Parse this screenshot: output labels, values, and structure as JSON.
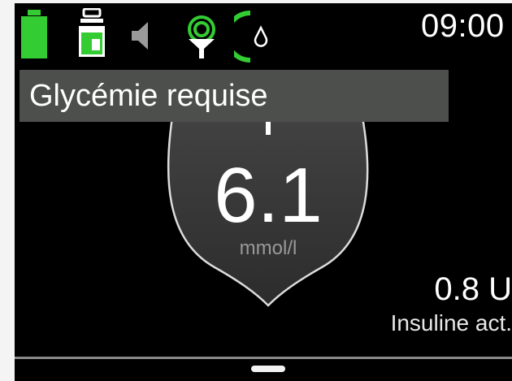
{
  "status_bar": {
    "time": "09:00",
    "icons": [
      "battery-full-icon",
      "insulin-reservoir-icon",
      "speaker-muted-icon",
      "cgm-signal-icon",
      "sensor-status-icon"
    ],
    "accent_color": "#33cc33"
  },
  "banner": {
    "text": "Glycémie requise"
  },
  "glucose": {
    "value": "6.1",
    "unit": "mmol/l"
  },
  "insulin_on_board": {
    "value": "0.8 U",
    "label": "Insuline act."
  }
}
